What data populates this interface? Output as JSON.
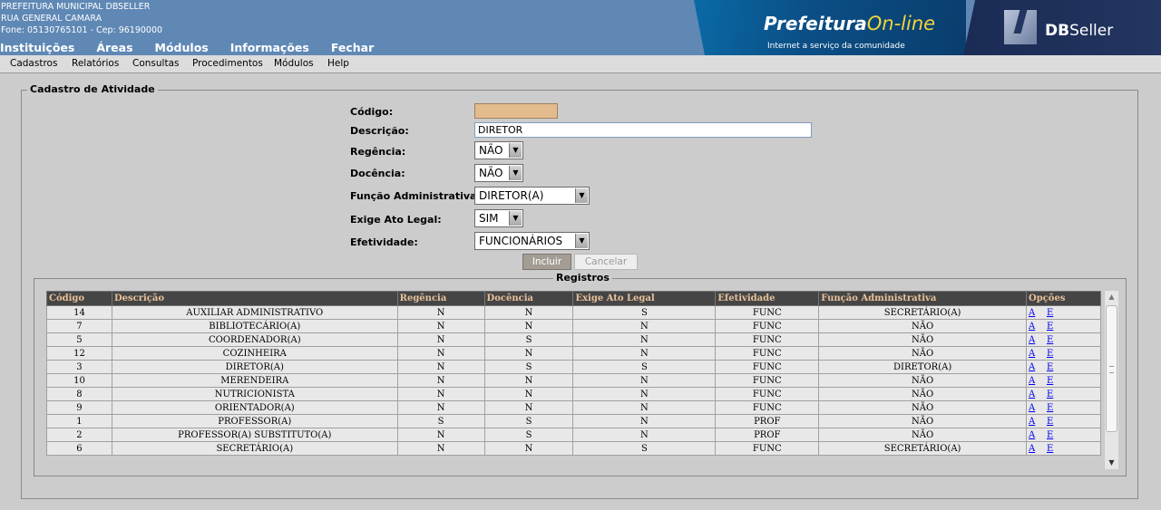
{
  "header": {
    "org_name": "PREFEITURA MUNICIPAL DBSELLER",
    "street": "RUA GENERAL CAMARA",
    "contact": "Fone: 05130765101  -  Cep: 96190000",
    "menu": [
      "Instituições",
      "Áreas",
      "Módulos",
      "Informações",
      "Fechar"
    ],
    "pref_logo_part1": "Prefeitura",
    "pref_logo_part2": "On-line",
    "pref_tagline": "Internet a serviço da comunidade",
    "db_logo_bold": "DB",
    "db_logo_rest": "Seller"
  },
  "menubar": [
    "Cadastros",
    "Relatórios",
    "Consultas",
    "Procedimentos",
    "Módulos",
    "Help"
  ],
  "form": {
    "legend": "Cadastro de Atividade",
    "codigo_label": "Código:",
    "codigo_value": "",
    "descricao_label": "Descrição:",
    "descricao_value": "DIRETOR",
    "regencia_label": "Regência:",
    "regencia_value": "NÃO",
    "docencia_label": "Docência:",
    "docencia_value": "NÃO",
    "funcao_label": "Função Administrativa:",
    "funcao_value": "DIRETOR(A)",
    "ato_label": "Exige Ato Legal:",
    "ato_value": "SIM",
    "efetividade_label": "Efetividade:",
    "efetividade_value": "FUNCIONÁRIOS",
    "incluir_label": "Incluir",
    "cancelar_label": "Cancelar"
  },
  "registros": {
    "legend": "Registros",
    "columns": [
      "Código",
      "Descrição",
      "Regência",
      "Docência",
      "Exige Ato Legal",
      "Efetividade",
      "Função Administrativa",
      "Opções"
    ],
    "option_a": "A",
    "option_e": "E",
    "rows": [
      [
        "14",
        "AUXILIAR ADMINISTRATIVO",
        "N",
        "N",
        "S",
        "FUNC",
        "SECRETÁRIO(A)"
      ],
      [
        "7",
        "BIBLIOTECÁRIO(A)",
        "N",
        "N",
        "N",
        "FUNC",
        "NÃO"
      ],
      [
        "5",
        "COORDENADOR(A)",
        "N",
        "S",
        "N",
        "FUNC",
        "NÃO"
      ],
      [
        "12",
        "COZINHEIRA",
        "N",
        "N",
        "N",
        "FUNC",
        "NÃO"
      ],
      [
        "3",
        "DIRETOR(A)",
        "N",
        "S",
        "S",
        "FUNC",
        "DIRETOR(A)"
      ],
      [
        "10",
        "MERENDEIRA",
        "N",
        "N",
        "N",
        "FUNC",
        "NÃO"
      ],
      [
        "8",
        "NUTRICIONISTA",
        "N",
        "N",
        "N",
        "FUNC",
        "NÃO"
      ],
      [
        "9",
        "ORIENTADOR(A)",
        "N",
        "N",
        "N",
        "FUNC",
        "NÃO"
      ],
      [
        "1",
        "PROFESSOR(A)",
        "S",
        "S",
        "N",
        "PROF",
        "NÃO"
      ],
      [
        "2",
        "PROFESSOR(A) SUBSTITUTO(A)",
        "N",
        "S",
        "N",
        "PROF",
        "NÃO"
      ],
      [
        "6",
        "SECRETÁRIO(A)",
        "N",
        "N",
        "S",
        "FUNC",
        "SECRETÁRIO(A)"
      ]
    ]
  }
}
